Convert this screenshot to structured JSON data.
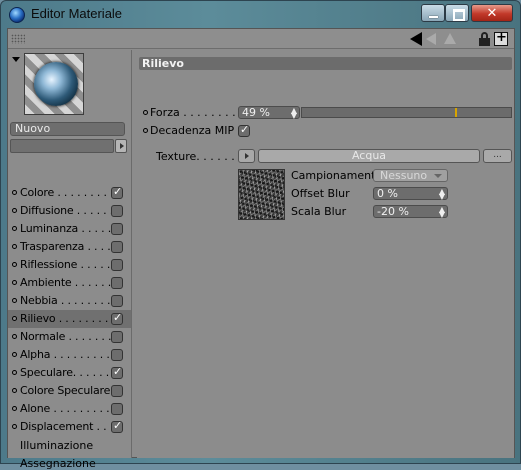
{
  "window": {
    "title": "Editor Materiale",
    "close_glyph": "✕"
  },
  "toolbar": {
    "icons": [
      "grip-icon",
      "back-arrow-icon",
      "forward-arrow-icon",
      "up-arrow-icon",
      "lock-icon",
      "new-window-icon"
    ]
  },
  "material": {
    "name": "Nuovo"
  },
  "channels": [
    {
      "label": "Colore . . . . . . . .",
      "checked": true
    },
    {
      "label": "Diffusione . . . . . .",
      "checked": false
    },
    {
      "label": "Luminanza . . . . .",
      "checked": false
    },
    {
      "label": "Trasparenza . . . .",
      "checked": false
    },
    {
      "label": "Riflessione . . . . .",
      "checked": false
    },
    {
      "label": "Ambiente . . . . . .",
      "checked": false
    },
    {
      "label": "Nebbia . . . . . . . .",
      "checked": false
    },
    {
      "label": "Rilievo . . . . . . . .",
      "checked": true,
      "active": true
    },
    {
      "label": "Normale . . . . . . .",
      "checked": false
    },
    {
      "label": "Alpha . . . . . . . . .",
      "checked": false
    },
    {
      "label": "Speculare. . . . . .",
      "checked": true
    },
    {
      "label": "Colore Speculare",
      "checked": false
    },
    {
      "label": "Alone . . . . . . . . .",
      "checked": false
    },
    {
      "label": "Displacement . .",
      "checked": true
    }
  ],
  "extra_items": [
    "Illuminazione",
    "Assegnazione"
  ],
  "panel": {
    "title": "Rilievo",
    "forza_label": "Forza . . . . . . . .",
    "forza_value": "49 %",
    "forza_fraction": 0.49,
    "mip_label": "Decadenza MIP",
    "mip_checked": true,
    "texture_label": "Texture. . . . . . .",
    "texture_name": "Acqua",
    "browse_label": "...",
    "campionamento_label": "Campionamento",
    "campionamento_value": "Nessuno",
    "offset_blur_label": "Offset Blur",
    "offset_blur_value": "0 %",
    "scala_blur_label": "Scala Blur",
    "scala_blur_value": "-20 %"
  }
}
